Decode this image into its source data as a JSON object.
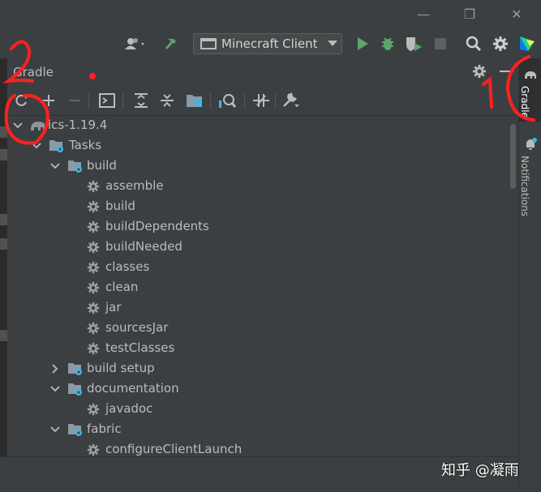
{
  "window": {
    "minimize_glyph": "—",
    "restore_glyph": "❐",
    "close_glyph": "✕"
  },
  "run_toolbar": {
    "config_label": "Minecraft Client",
    "icons": [
      "user-icon",
      "hammer-icon",
      "run-icon",
      "debug-icon",
      "coverage-icon",
      "stop-icon",
      "search-icon",
      "settings-icon",
      "jetbrains-icon"
    ]
  },
  "panel": {
    "title": "Gradle",
    "toolbar_icons": [
      "reload-icon",
      "add-icon",
      "remove-icon",
      "run-task-icon",
      "expand-all-icon",
      "collapse-all-icon",
      "dependencies-icon",
      "analyze-icon",
      "offline-mode-icon",
      "build-settings-icon"
    ]
  },
  "tree": {
    "rows": [
      {
        "label": "ics-1.19.4",
        "depth": 0,
        "arrow": "down",
        "icon": "elephant"
      },
      {
        "label": "Tasks",
        "depth": 1,
        "arrow": "down",
        "icon": "folder"
      },
      {
        "label": "build",
        "depth": 2,
        "arrow": "down",
        "icon": "folder"
      },
      {
        "label": "assemble",
        "depth": 3,
        "arrow": "none",
        "icon": "gear"
      },
      {
        "label": "build",
        "depth": 3,
        "arrow": "none",
        "icon": "gear"
      },
      {
        "label": "buildDependents",
        "depth": 3,
        "arrow": "none",
        "icon": "gear"
      },
      {
        "label": "buildNeeded",
        "depth": 3,
        "arrow": "none",
        "icon": "gear"
      },
      {
        "label": "classes",
        "depth": 3,
        "arrow": "none",
        "icon": "gear"
      },
      {
        "label": "clean",
        "depth": 3,
        "arrow": "none",
        "icon": "gear"
      },
      {
        "label": "jar",
        "depth": 3,
        "arrow": "none",
        "icon": "gear"
      },
      {
        "label": "sourcesJar",
        "depth": 3,
        "arrow": "none",
        "icon": "gear"
      },
      {
        "label": "testClasses",
        "depth": 3,
        "arrow": "none",
        "icon": "gear"
      },
      {
        "label": "build setup",
        "depth": 2,
        "arrow": "right",
        "icon": "folder"
      },
      {
        "label": "documentation",
        "depth": 2,
        "arrow": "down",
        "icon": "folder"
      },
      {
        "label": "javadoc",
        "depth": 3,
        "arrow": "none",
        "icon": "gear"
      },
      {
        "label": "fabric",
        "depth": 2,
        "arrow": "down",
        "icon": "folder"
      },
      {
        "label": "configureClientLaunch",
        "depth": 3,
        "arrow": "none",
        "icon": "gear"
      }
    ]
  },
  "side_tabs": {
    "gradle": "Gradle",
    "notifications": "Notifications"
  },
  "watermark": "知乎 @凝雨",
  "colors": {
    "accent_green": "#59a869",
    "debug_green": "#59a869",
    "folder_gray": "#8a9aa6",
    "blue_gear": "#40b6e0",
    "annotation_red": "#ff2020"
  }
}
